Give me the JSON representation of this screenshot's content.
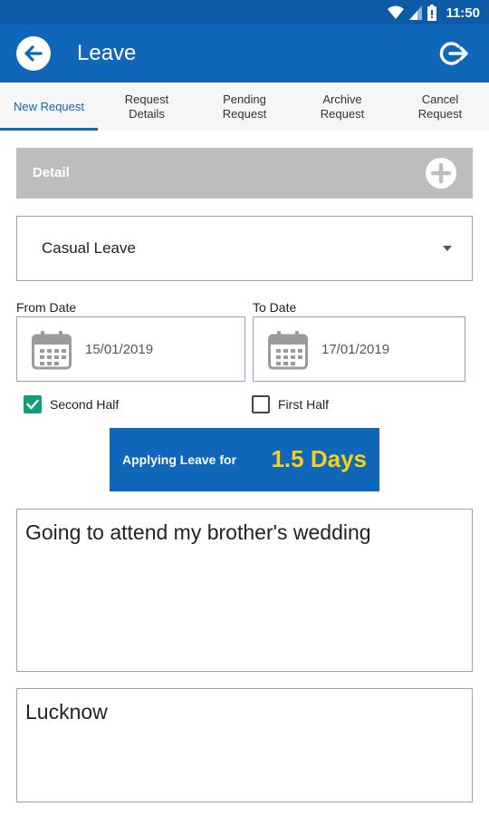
{
  "status_bar": {
    "time": "11:50",
    "icons": [
      "wifi-icon",
      "signal-icon",
      "battery-icon"
    ]
  },
  "app_bar": {
    "title": "Leave",
    "back_icon": "back-arrow-icon",
    "logout_icon": "logout-icon"
  },
  "tabs": [
    {
      "label": "New Request",
      "active": true
    },
    {
      "label": "Request\nDetails",
      "active": false
    },
    {
      "label": "Pending\nRequest",
      "active": false
    },
    {
      "label": "Archive\nRequest",
      "active": false
    },
    {
      "label": "Cancel\nRequest",
      "active": false
    }
  ],
  "detail": {
    "label": "Detail",
    "add_icon": "plus-circle-icon"
  },
  "leave_type": {
    "selected": "Casual Leave"
  },
  "dates": {
    "from_label": "From Date",
    "from_value": "15/01/2019",
    "to_label": "To Date",
    "to_value": "17/01/2019"
  },
  "half_day": {
    "second_half_label": "Second Half",
    "second_half_checked": true,
    "first_half_label": "First Half",
    "first_half_checked": false
  },
  "summary": {
    "label": "Applying Leave for",
    "value": "1.5 Days"
  },
  "reason": {
    "value": "Going to attend my brother's wedding"
  },
  "location": {
    "value": "Lucknow"
  },
  "colors": {
    "primary": "#1066b9",
    "status_bar": "#0d5aa7",
    "accent_yellow": "#f7d117",
    "checkbox_green": "#139e79",
    "detail_gray": "#bdbdbd",
    "field_border": "#8fa0d8"
  }
}
